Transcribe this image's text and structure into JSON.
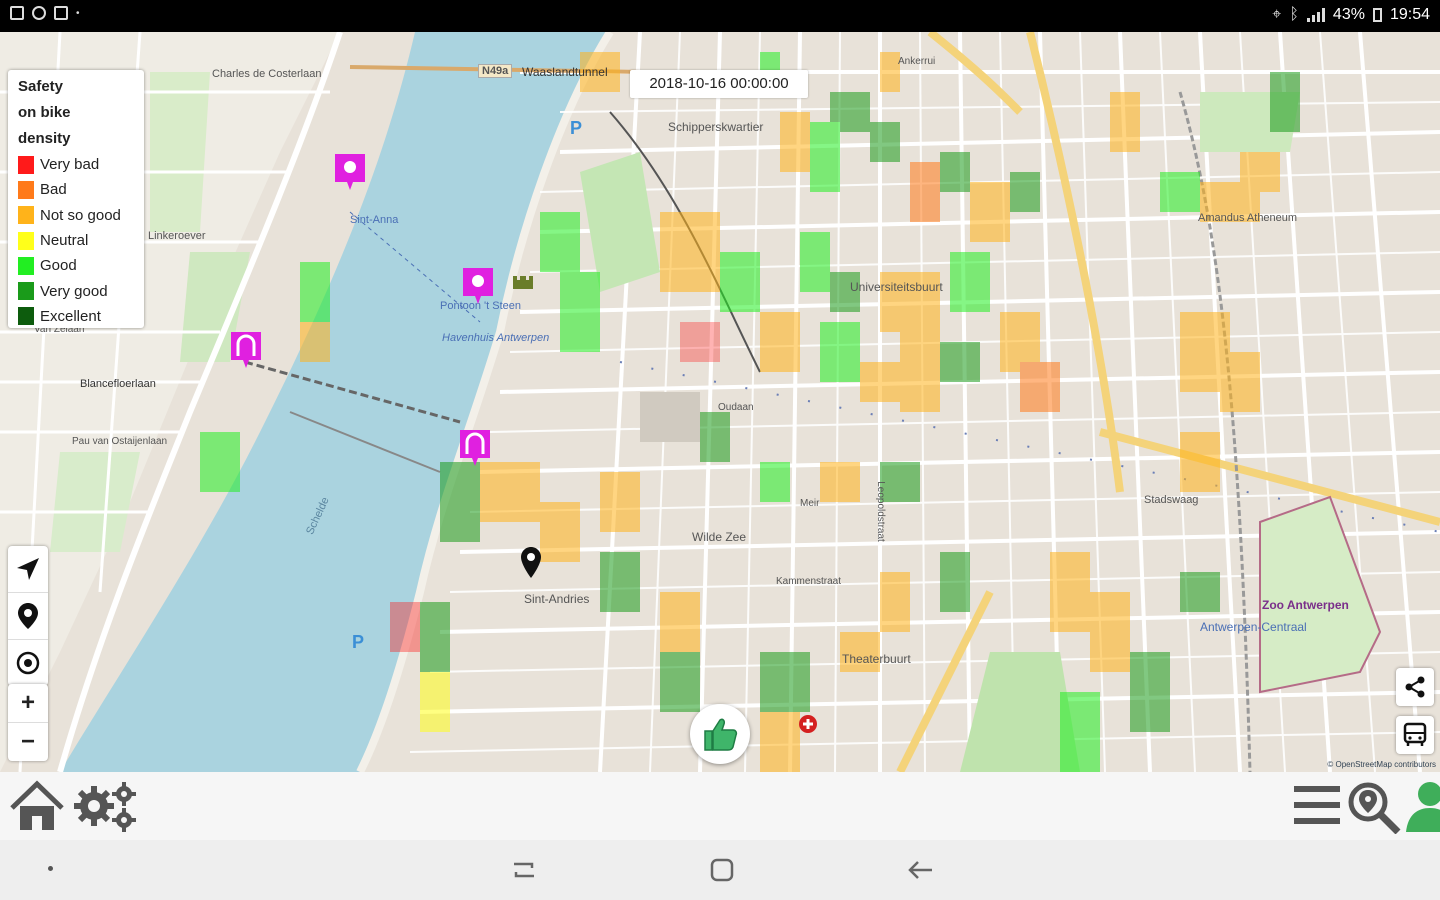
{
  "status_bar": {
    "battery": "43%",
    "time": "19:54"
  },
  "legend": {
    "title_lines": [
      "Safety",
      "on bike",
      "density"
    ],
    "items": [
      {
        "label": "Very bad",
        "color": "#ff1a1a"
      },
      {
        "label": "Bad",
        "color": "#ff7a1a"
      },
      {
        "label": "Not so good",
        "color": "#ffb31a"
      },
      {
        "label": "Neutral",
        "color": "#ffff1a"
      },
      {
        "label": "Good",
        "color": "#22ee22"
      },
      {
        "label": "Very good",
        "color": "#1a9b1a"
      },
      {
        "label": "Excellent",
        "color": "#0d5c0d"
      }
    ]
  },
  "map": {
    "timestamp": "2018-10-16 00:00:00",
    "labels": {
      "charles": "Charles de Costerlaan",
      "n49a": "N49a",
      "waasland": "Waaslandtunnel",
      "schipperskwartier": "Schipperskwartier",
      "linkeroever": "Linkeroever",
      "zeelaan": "Van Zelaan",
      "blancefloer": "Blancefloerlaan",
      "oosterlaan": "Pau van Ostaijenlaan",
      "stanna": "Sint-Anna",
      "steen": "Pontoon 't Steen",
      "haven": "Havenhuis Antwerpen",
      "universiteit": "Universiteitsbuurt",
      "amandus": "Amandus Atheneum",
      "stadswaag": "Stadswaag",
      "wildezee": "Wilde Zee",
      "sintandries": "Sint-Andries",
      "theaterbuurt": "Theaterbuurt",
      "zoo": "Zoo Antwerpen",
      "centraal": "Antwerpen-Centraal",
      "schelde": "Schelde",
      "meir": "Meir",
      "kammenstraat": "Kammenstraat",
      "ankerrui": "Ankerrui",
      "oudaan": "Oudaan",
      "leopold": "Leopoldstraat"
    },
    "attribution": "© OpenStreetMap contributors"
  },
  "controls": {
    "zoom_in": "+",
    "zoom_out": "−"
  },
  "icons": {
    "locate": "navigation-arrow-icon",
    "pin": "map-pin-icon",
    "center": "target-icon",
    "share": "share-icon",
    "bus": "bus-icon",
    "thumb": "thumbs-up-icon",
    "home": "home-icon",
    "settings": "gears-icon",
    "menu": "hamburger-icon",
    "search": "map-search-icon",
    "user": "user-icon"
  }
}
